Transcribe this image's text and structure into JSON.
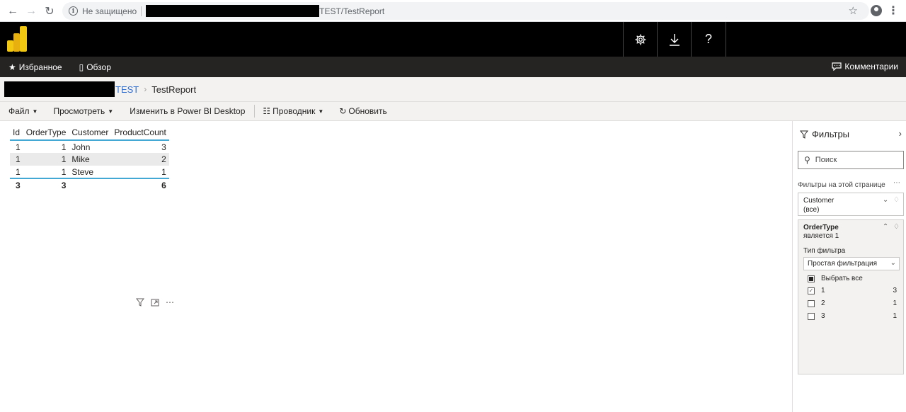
{
  "browser": {
    "not_secure": "Не защищено",
    "url_path": "TEST/TestReport"
  },
  "header": {
    "settings_icon": "gear-icon",
    "download_icon": "download-icon",
    "help_label": "?"
  },
  "nav": {
    "favorites": "Избранное",
    "browse": "Обзор",
    "comments": "Комментарии"
  },
  "breadcrumb": {
    "workspace": "TEST",
    "report": "TestReport"
  },
  "toolbar": {
    "file": "Файл",
    "view": "Просмотреть",
    "edit_desktop": "Изменить в Power BI Desktop",
    "explorer": "Проводник",
    "refresh": "Обновить"
  },
  "table": {
    "columns": [
      "Id",
      "OrderType",
      "Customer",
      "ProductCount"
    ],
    "rows": [
      [
        "1",
        "1",
        "John",
        "3"
      ],
      [
        "1",
        "1",
        "Mike",
        "2"
      ],
      [
        "1",
        "1",
        "Steve",
        "1"
      ]
    ],
    "total": [
      "3",
      "3",
      "",
      "6"
    ]
  },
  "filters": {
    "title": "Фильтры",
    "search_placeholder": "Поиск",
    "page_filters_label": "Фильтры на этой странице",
    "customer": {
      "field": "Customer",
      "value": "(все)"
    },
    "order_type": {
      "field": "OrderType",
      "condition": "является 1",
      "type_label": "Тип фильтра",
      "type_value": "Простая фильтрация",
      "select_all": "Выбрать все",
      "options": [
        {
          "label": "1",
          "count": "3",
          "checked": true
        },
        {
          "label": "2",
          "count": "1",
          "checked": false
        },
        {
          "label": "3",
          "count": "1",
          "checked": false
        }
      ]
    }
  },
  "colors": {
    "accent_line": "#43a8d4",
    "link": "#2f6fd0",
    "logo_yellow": "#f2c811"
  }
}
